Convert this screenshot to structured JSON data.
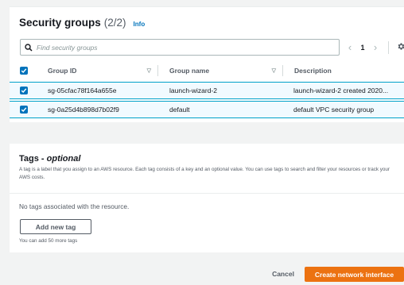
{
  "security_groups": {
    "title": "Security groups",
    "count": "(2/2)",
    "info_link": "Info",
    "search": {
      "placeholder": "Find security groups"
    },
    "pagination": {
      "prev": "‹",
      "page": "1",
      "next": "›"
    },
    "columns": {
      "group_id": "Group ID",
      "group_name": "Group name",
      "description": "Description"
    },
    "rows": [
      {
        "group_id": "sg-05cfac78f164a655e",
        "group_name": "launch-wizard-2",
        "description": "launch-wizard-2 created 2020...",
        "selected": true
      },
      {
        "group_id": "sg-0a25d4b898d7b02f9",
        "group_name": "default",
        "description": "default VPC security group",
        "selected": true
      }
    ]
  },
  "tags": {
    "title": "Tags",
    "title_suffix": "optional",
    "title_sep": " - ",
    "description": "A tag is a label that you assign to an AWS resource. Each tag consists of a key and an optional value. You can use tags to search and filter your resources or track your AWS costs.",
    "empty_message": "No tags associated with the resource.",
    "add_button": "Add new tag",
    "limit_note": "You can add 50 more tags"
  },
  "footer": {
    "cancel": "Cancel",
    "create": "Create network interface"
  },
  "colors": {
    "accent_blue": "#0073bb",
    "selected_row_bg": "#f1faff",
    "selected_row_border": "#00a1c9",
    "primary_orange": "#ec7211",
    "page_bg": "#f2f3f3"
  },
  "icons": {
    "search": "search-icon",
    "settings": "gear-icon",
    "sort": "sort-caret-icon",
    "checkbox": "checkbox-checked-icon"
  }
}
